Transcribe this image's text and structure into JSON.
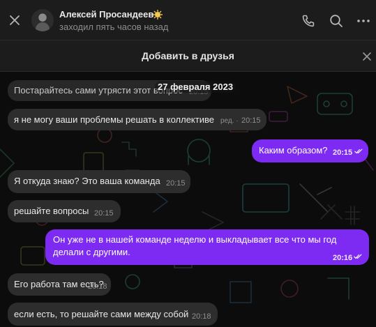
{
  "header": {
    "name": "Алексей Просандеев",
    "status": "заходил пять часов назад",
    "icons": [
      "close-icon",
      "avatar",
      "star-badge-icon",
      "phone-icon",
      "search-icon",
      "more-icon"
    ]
  },
  "friend_bar": {
    "label": "Добавить в друзья"
  },
  "chat": {
    "date": "27 февраля 2023",
    "messages": [
      {
        "direction": "in",
        "text": "Постарайтесь сами утрясти этот вопрос",
        "time": "20:15"
      },
      {
        "direction": "in",
        "text": "я не могу ваши проблемы решать в коллективе",
        "edited": "ред. ·",
        "time": "20:15"
      },
      {
        "direction": "out",
        "text": "Каким образом?",
        "time": "20:15"
      },
      {
        "direction": "in",
        "text": "Я откуда знаю? Это ваша команда",
        "time": "20:15"
      },
      {
        "direction": "in",
        "text": "решайте вопросы",
        "time": "20:15"
      },
      {
        "direction": "out",
        "text": "Он уже не в нашей команде неделю и выкладывает все что мы год делали с другими.",
        "time": "20:16"
      },
      {
        "direction": "in",
        "text": "Его работа там есть?",
        "time": "20:18"
      },
      {
        "direction": "in",
        "text": "если есть, то решайте сами между собой",
        "time": "20:18"
      }
    ]
  },
  "colors": {
    "outgoing_bubble": "#7d2bf2",
    "incoming_bubble": "#2d2d2d",
    "header_bg": "#1c1c1c",
    "chat_bg": "#0c0c0c"
  }
}
